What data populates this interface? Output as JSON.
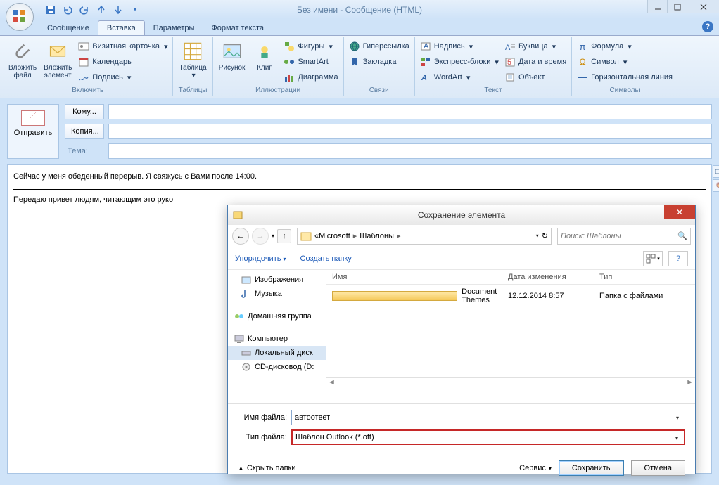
{
  "window": {
    "title": "Без имени - Сообщение (HTML)"
  },
  "tabs": {
    "t1": "Сообщение",
    "t2": "Вставка",
    "t3": "Параметры",
    "t4": "Формат текста"
  },
  "ribbon": {
    "include": {
      "attach_file": "Вложить\nфайл",
      "attach_item": "Вложить\nэлемент",
      "biz_card": "Визитная карточка",
      "calendar": "Календарь",
      "signature": "Подпись",
      "label": "Включить"
    },
    "tables": {
      "table": "Таблица",
      "label": "Таблицы"
    },
    "illus": {
      "picture": "Рисунок",
      "clip": "Клип",
      "shapes": "Фигуры",
      "smartart": "SmartArt",
      "chart": "Диаграмма",
      "label": "Иллюстрации"
    },
    "links": {
      "hyperlink": "Гиперссылка",
      "bookmark": "Закладка",
      "label": "Связи"
    },
    "text": {
      "textbox": "Надпись",
      "quick": "Экспресс-блоки",
      "wordart": "WordArt",
      "dropcap": "Буквица",
      "datetime": "Дата и время",
      "object": "Объект",
      "label": "Текст"
    },
    "symbols": {
      "equation": "Формула",
      "symbol": "Символ",
      "hline": "Горизонтальная линия",
      "label": "Символы"
    }
  },
  "compose": {
    "send": "Отправить",
    "to_btn": "Кому...",
    "cc_btn": "Копия...",
    "subject_label": "Тема:",
    "to_val": "",
    "cc_val": "",
    "subject_val": ""
  },
  "body": {
    "line1": "Сейчас у меня обеденный перерыв. Я свяжусь с Вами после 14:00.",
    "line2": "Передаю привет людям, читающим это руко"
  },
  "dialog": {
    "title": "Сохранение элемента",
    "breadcrumb_prefix": "«",
    "bc1": "Microsoft",
    "bc2": "Шаблоны",
    "search_placeholder": "Поиск: Шаблоны",
    "organize": "Упорядочить",
    "new_folder": "Создать папку",
    "col_name": "Имя",
    "col_date": "Дата изменения",
    "col_type": "Тип",
    "row_name": "Document Themes",
    "row_date": "12.12.2014 8:57",
    "row_type": "Папка с файлами",
    "tree": {
      "images": "Изображения",
      "music": "Музыка",
      "homegroup": "Домашняя группа",
      "computer": "Компьютер",
      "localdisk": "Локальный диск",
      "cddrive": "CD-дисковод (D:"
    },
    "filename_label": "Имя файла:",
    "filename_val": "автоответ",
    "filetype_label": "Тип файла:",
    "filetype_val": "Шаблон Outlook (*.oft)",
    "hide": "Скрыть папки",
    "tools": "Сервис",
    "save": "Сохранить",
    "cancel": "Отмена"
  }
}
